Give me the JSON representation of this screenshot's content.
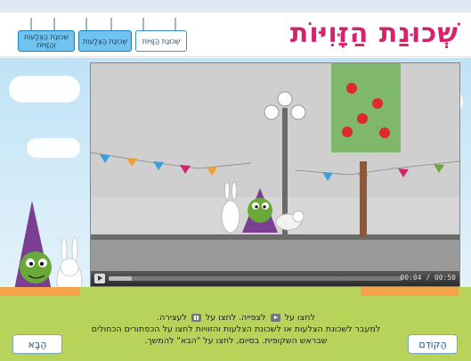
{
  "header": {
    "title": "שְׁכוּנַת הַזָּוִיּוֹת",
    "tabs": [
      {
        "label": "שְׁכוּנַת הַזָּוִיּוֹת",
        "state": "active"
      },
      {
        "label": "שְׁכוּנַת הַצְּלָעוֹת",
        "state": "inactive"
      },
      {
        "label": "שְׁכוּנַת הַצְּלָעוֹת וְהַזָּוִיּוֹת",
        "state": "inactive"
      }
    ]
  },
  "video": {
    "timecode": "00:04 / 00:50",
    "progress": 0.08
  },
  "instructions": {
    "line1_before_play": "לחצו על",
    "line1_after_play": "לצפייה. לחצו על",
    "line1_after_pause": "לעצירה.",
    "line2": "למעבר לשכונת הצלעות או לשכונת הצלעות והזוויות לחצו על הכפתורים הכחולים",
    "line3": "שבראש השקופית. בסיום, לחצו על \"הבא\" להמשך."
  },
  "nav": {
    "next_label": "הַבָּא",
    "prev_label": "הַקּוֹדֵם"
  },
  "colors": {
    "title": "#d6226a",
    "tab_blue": "#6fc3ee",
    "grass": "#b8d35a",
    "accent_orange": "#f5a34a"
  }
}
